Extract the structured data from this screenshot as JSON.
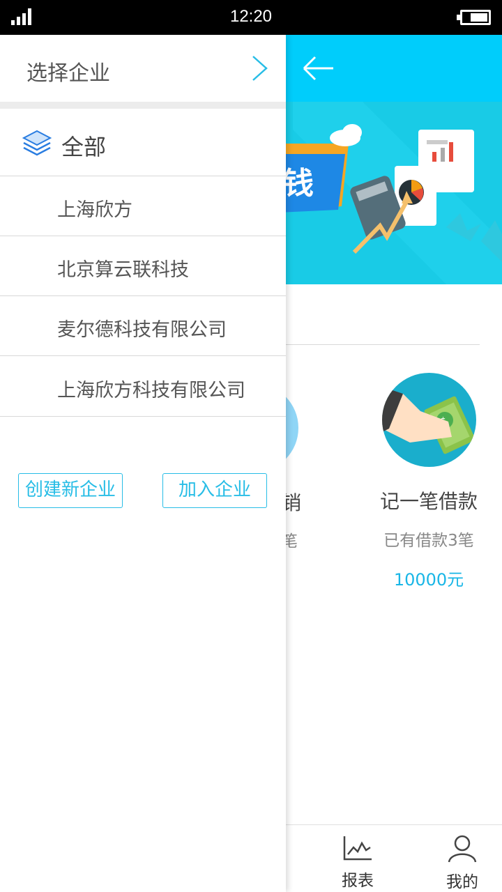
{
  "status": {
    "time": "12:20"
  },
  "banner": {
    "text_fragment": "钱"
  },
  "main": {
    "left_card_fragment_title": "销",
    "left_card_fragment_sub": "笔",
    "loan_card": {
      "title": "记一笔借款",
      "count": "已有借款3笔",
      "amount": "10000元"
    }
  },
  "tabbar": {
    "tabs": [
      {
        "label": "报表",
        "icon": "chart-icon"
      },
      {
        "label": "我的",
        "icon": "user-icon"
      }
    ]
  },
  "drawer": {
    "title": "选择企业",
    "all_label": "全部",
    "companies": [
      "上海欣方",
      "北京算云联科技",
      "麦尔德科技有限公司",
      "上海欣方科技有限公司"
    ],
    "create_button": "创建新企业",
    "join_button": "加入企业"
  },
  "colors": {
    "accent": "#00cdfb",
    "button_border": "#27bde6",
    "amount": "#19b6e6"
  }
}
